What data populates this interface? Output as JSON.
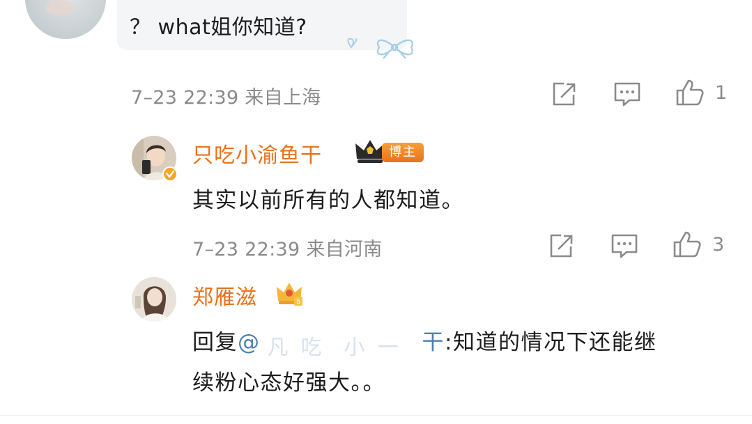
{
  "comment1": {
    "text": "？ what姐你知道?",
    "meta": "7–23 22:39 来自上海",
    "like_count": "1"
  },
  "reply1": {
    "name": "只吃小渝鱼干",
    "badge": "博主",
    "text": "其实以前所有的人都知道。",
    "meta": "7–23 22:39 来自河南",
    "like_count": "3"
  },
  "reply2": {
    "name": "郑雁滋",
    "text_prefix": "回复",
    "mention_at": "@",
    "mention_end": "干",
    "text_line1": ":知道的情况下还能继",
    "text_line2": "续粉心态好强大。。"
  },
  "colors": {
    "name": "#e9721c",
    "meta": "#8a8a8a",
    "mention": "#4a7fb5",
    "badge": "#e9711a"
  },
  "icons": [
    "share-icon",
    "comment-icon",
    "like-icon",
    "crown-icon",
    "verified-icon",
    "bow-decoration-icon"
  ]
}
